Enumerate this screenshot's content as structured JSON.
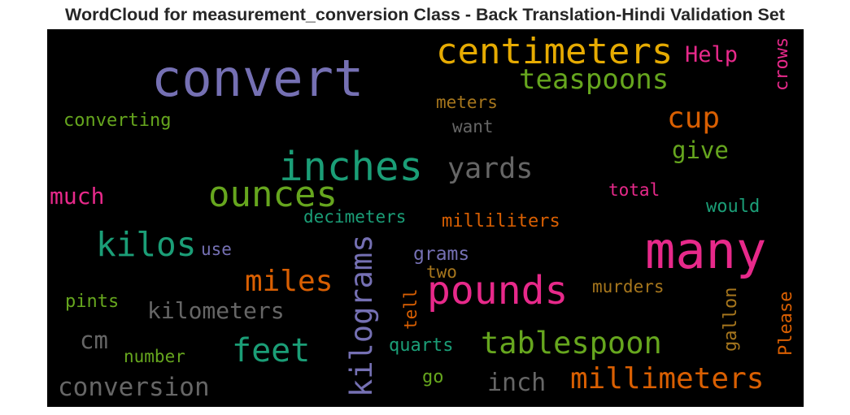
{
  "chart_data": {
    "type": "wordcloud",
    "title": "WordCloud for measurement_conversion Class - Back Translation-Hindi Validation Set",
    "background": "#000000",
    "colormap": [
      "#7570b3",
      "#1b9e77",
      "#d95f02",
      "#e7298a",
      "#66a61e",
      "#e6ab02",
      "#a6761d",
      "#666666"
    ],
    "words": [
      {
        "text": "convert",
        "color": "#7570b3",
        "orientation": "horizontal"
      },
      {
        "text": "centimeters",
        "color": "#e6ab02",
        "orientation": "horizontal"
      },
      {
        "text": "Help",
        "color": "#e7298a",
        "orientation": "horizontal"
      },
      {
        "text": "crows",
        "color": "#e7298a",
        "orientation": "vertical"
      },
      {
        "text": "teaspoons",
        "color": "#66a61e",
        "orientation": "horizontal"
      },
      {
        "text": "meters",
        "color": "#a6761d",
        "orientation": "horizontal"
      },
      {
        "text": "converting",
        "color": "#66a61e",
        "orientation": "horizontal"
      },
      {
        "text": "want",
        "color": "#666666",
        "orientation": "horizontal"
      },
      {
        "text": "cup",
        "color": "#d95f02",
        "orientation": "horizontal"
      },
      {
        "text": "give",
        "color": "#66a61e",
        "orientation": "horizontal"
      },
      {
        "text": "inches",
        "color": "#1b9e77",
        "orientation": "horizontal"
      },
      {
        "text": "yards",
        "color": "#666666",
        "orientation": "horizontal"
      },
      {
        "text": "total",
        "color": "#e7298a",
        "orientation": "horizontal"
      },
      {
        "text": "much",
        "color": "#e7298a",
        "orientation": "horizontal"
      },
      {
        "text": "ounces",
        "color": "#66a61e",
        "orientation": "horizontal"
      },
      {
        "text": "would",
        "color": "#1b9e77",
        "orientation": "horizontal"
      },
      {
        "text": "decimeters",
        "color": "#1b9e77",
        "orientation": "horizontal"
      },
      {
        "text": "milliliters",
        "color": "#d95f02",
        "orientation": "horizontal"
      },
      {
        "text": "many",
        "color": "#e7298a",
        "orientation": "horizontal"
      },
      {
        "text": "kilos",
        "color": "#1b9e77",
        "orientation": "horizontal"
      },
      {
        "text": "use",
        "color": "#7570b3",
        "orientation": "horizontal"
      },
      {
        "text": "grams",
        "color": "#7570b3",
        "orientation": "horizontal"
      },
      {
        "text": "kilograms",
        "color": "#7570b3",
        "orientation": "vertical"
      },
      {
        "text": "two",
        "color": "#a6761d",
        "orientation": "horizontal"
      },
      {
        "text": "miles",
        "color": "#d95f02",
        "orientation": "horizontal"
      },
      {
        "text": "pounds",
        "color": "#e7298a",
        "orientation": "horizontal"
      },
      {
        "text": "murders",
        "color": "#a6761d",
        "orientation": "horizontal"
      },
      {
        "text": "pints",
        "color": "#66a61e",
        "orientation": "horizontal"
      },
      {
        "text": "kilometers",
        "color": "#666666",
        "orientation": "horizontal"
      },
      {
        "text": "tell",
        "color": "#d95f02",
        "orientation": "vertical"
      },
      {
        "text": "gallon",
        "color": "#a6761d",
        "orientation": "vertical"
      },
      {
        "text": "Please",
        "color": "#d95f02",
        "orientation": "vertical"
      },
      {
        "text": "cm",
        "color": "#666666",
        "orientation": "horizontal"
      },
      {
        "text": "feet",
        "color": "#1b9e77",
        "orientation": "horizontal"
      },
      {
        "text": "tablespoon",
        "color": "#66a61e",
        "orientation": "horizontal"
      },
      {
        "text": "number",
        "color": "#66a61e",
        "orientation": "horizontal"
      },
      {
        "text": "quarts",
        "color": "#1b9e77",
        "orientation": "horizontal"
      },
      {
        "text": "millimeters",
        "color": "#d95f02",
        "orientation": "horizontal"
      },
      {
        "text": "go",
        "color": "#66a61e",
        "orientation": "horizontal"
      },
      {
        "text": "inch",
        "color": "#666666",
        "orientation": "horizontal"
      },
      {
        "text": "conversion",
        "color": "#666666",
        "orientation": "horizontal"
      }
    ]
  }
}
